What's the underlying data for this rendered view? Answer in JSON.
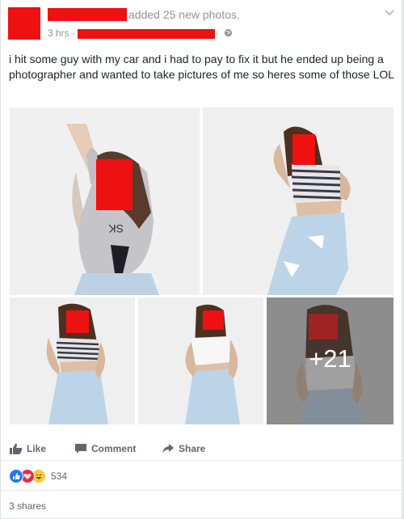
{
  "post": {
    "action_text": "added 25 new photos.",
    "time": "3 hrs",
    "separator": "·",
    "separator2": "·",
    "body": "i hit some guy with my car and i had to pay to fix it but he ended up being a photographer and wanted to take pictures of me so heres some of those LOL",
    "privacy_icon": "globe-icon",
    "menu_icon": "chevron-down-icon"
  },
  "photos": {
    "more_count": "+21",
    "shirt_text": "SK"
  },
  "actions": {
    "like_label": "Like",
    "comment_label": "Comment",
    "share_label": "Share"
  },
  "reactions": {
    "types": [
      "like",
      "love",
      "haha"
    ],
    "count": "534"
  },
  "shares": {
    "text": "3 shares"
  },
  "colors": {
    "redaction": "#ee1111",
    "meta_text": "#90949c",
    "body_text": "#1d2129",
    "action_text": "#606770",
    "like_blue": "#2078f4",
    "love_red": "#f0284a",
    "haha_yellow": "#fcc938"
  }
}
